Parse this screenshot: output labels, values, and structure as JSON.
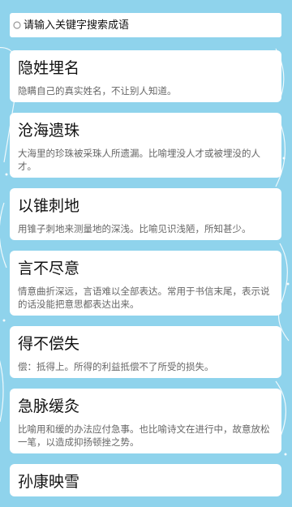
{
  "search": {
    "placeholder": "请输入关键字搜索成语"
  },
  "idioms": [
    {
      "title": "隐姓埋名",
      "desc": "隐瞒自己的真实姓名，不让别人知道。"
    },
    {
      "title": "沧海遗珠",
      "desc": "大海里的珍珠被采珠人所遗漏。比喻埋没人才或被埋没的人才。"
    },
    {
      "title": "以锥刺地",
      "desc": "用锥子刺地来测量地的深浅。比喻见识浅陋，所知甚少。"
    },
    {
      "title": "言不尽意",
      "desc": "情意曲折深远，言语难以全部表达。常用于书信末尾，表示说的话没能把意思都表达出来。"
    },
    {
      "title": "得不偿失",
      "desc": "偿：抵得上。所得的利益抵偿不了所受的损失。"
    },
    {
      "title": "急脉缓灸",
      "desc": "比喻用和缓的办法应付急事。也比喻诗文在进行中，故意放松一笔，以造成抑扬顿挫之势。"
    },
    {
      "title": "孙康映雪",
      "desc": ""
    }
  ]
}
